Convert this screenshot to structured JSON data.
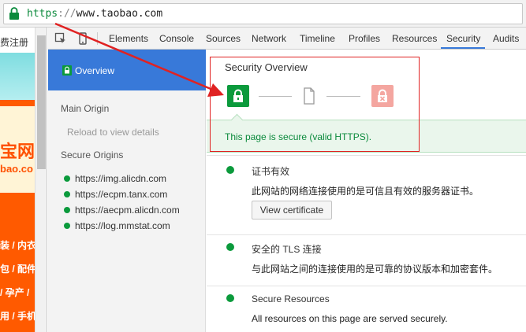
{
  "address_bar": {
    "scheme": "https",
    "separator": "://",
    "host": "www.taobao.com"
  },
  "page": {
    "register_text": "费注册",
    "logo_text": "宝网",
    "domain_text": "bao.co",
    "categories": [
      "装 / 内衣",
      "包 / 配件",
      "/ 孕产 /",
      "用 / 手机"
    ]
  },
  "devtools": {
    "tabs": [
      "Elements",
      "Console",
      "Sources",
      "Network",
      "Timeline",
      "Profiles",
      "Resources",
      "Security",
      "Audits"
    ],
    "active_tab": "Security"
  },
  "sidebar": {
    "overview_label": "Overview",
    "main_origin_heading": "Main Origin",
    "reload_text": "Reload to view details",
    "secure_origins_heading": "Secure Origins",
    "origins": [
      "https://img.alicdn.com",
      "https://ecpm.tanx.com",
      "https://aecpm.alicdn.com",
      "https://log.mmstat.com"
    ]
  },
  "main": {
    "title": "Security Overview",
    "summary": "This page is secure (valid HTTPS).",
    "sections": [
      {
        "title": "证书有效",
        "description": "此网站的网络连接使用的是可信且有效的服务器证书。",
        "button": "View certificate"
      },
      {
        "title": "安全的 TLS 连接",
        "description": "与此网站之间的连接使用的是可靠的协议版本和加密套件。"
      },
      {
        "title": "Secure Resources",
        "description": "All resources on this page are served securely."
      }
    ]
  },
  "colors": {
    "secure": "#0b9a3c",
    "accent": "#3879d9",
    "annotation": "#e02222",
    "insecure": "#f4a6a0"
  }
}
